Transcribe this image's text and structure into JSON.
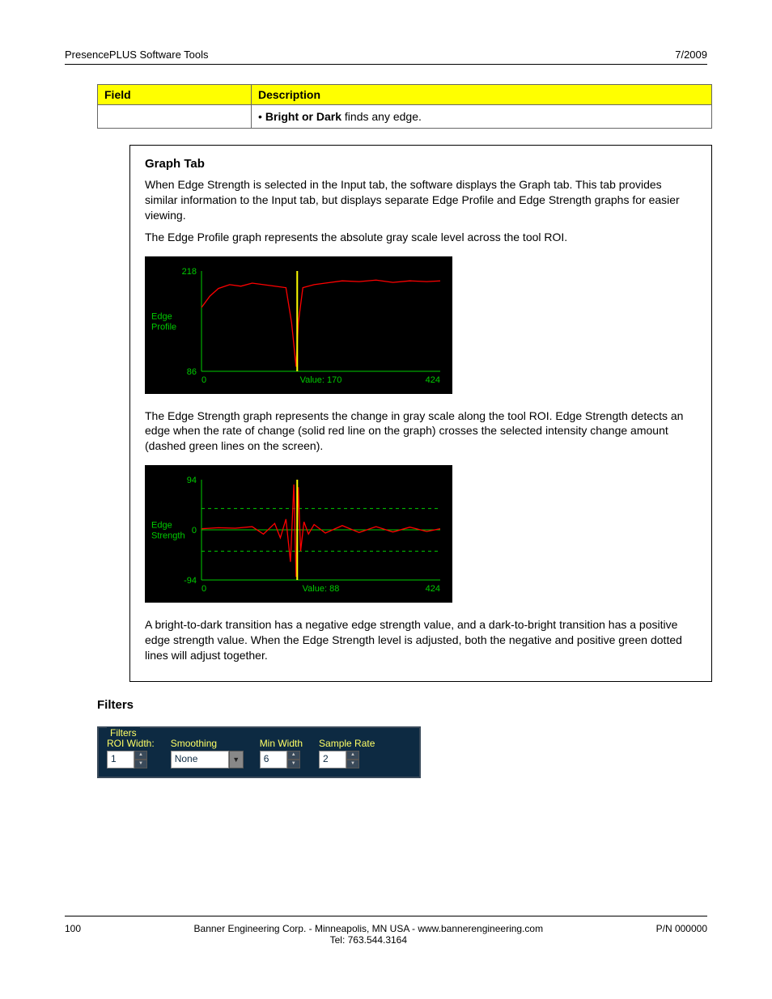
{
  "header": {
    "left": "PresencePLUS Software Tools",
    "right": "7/2009"
  },
  "table": {
    "headers": {
      "field": "Field",
      "description": "Description"
    },
    "row": {
      "field": "",
      "bold": "Bright or Dark",
      "rest": " finds any edge."
    }
  },
  "graph_tab": {
    "title": "Graph Tab",
    "p1": "When Edge Strength is selected in the Input tab, the software displays the Graph tab. This tab provides similar information to the Input tab, but displays separate Edge Profile and Edge Strength graphs for easier viewing.",
    "p2": "The Edge Profile graph represents the absolute gray scale level across the tool ROI.",
    "p3": "The Edge Strength graph represents the change in gray scale along the tool ROI. Edge Strength detects an edge when the rate of change (solid red line on the graph) crosses the selected intensity change amount (dashed green lines on the screen).",
    "p4": "A bright-to-dark transition has a negative edge strength value, and a dark-to-bright transition has a positive edge strength value. When the Edge Strength level is adjusted, both the negative and positive green dotted lines will adjust together."
  },
  "chart_data": [
    {
      "type": "line",
      "name": "Edge Profile",
      "ylabel": "Edge Profile",
      "ylim": [
        86,
        218
      ],
      "xlim": [
        0,
        424
      ],
      "xticks": [
        "0",
        "424"
      ],
      "yticks": [
        "86",
        "218"
      ],
      "marker_x": 170,
      "marker_label": "Value:  170",
      "series": [
        {
          "name": "profile",
          "color": "#ff0000",
          "x": [
            0,
            15,
            30,
            50,
            70,
            90,
            110,
            130,
            150,
            160,
            168,
            172,
            180,
            190,
            200,
            220,
            250,
            280,
            310,
            340,
            370,
            400,
            424
          ],
          "values": [
            170,
            185,
            195,
            200,
            198,
            202,
            200,
            198,
            196,
            150,
            92,
            150,
            196,
            198,
            200,
            202,
            205,
            204,
            206,
            203,
            205,
            204,
            205
          ]
        }
      ]
    },
    {
      "type": "line",
      "name": "Edge Strength",
      "ylabel": "Edge Strength",
      "ylim": [
        -94,
        94
      ],
      "xlim": [
        0,
        424
      ],
      "xticks": [
        "0",
        "424"
      ],
      "yticks": [
        "-94",
        "0",
        "94"
      ],
      "thresholds": [
        40,
        -40
      ],
      "marker_x": 170,
      "marker_label": "Value:  88",
      "series": [
        {
          "name": "strength",
          "color": "#ff0000",
          "x": [
            0,
            30,
            60,
            90,
            110,
            130,
            140,
            150,
            158,
            164,
            168,
            172,
            176,
            182,
            190,
            200,
            220,
            250,
            280,
            310,
            340,
            370,
            400,
            424
          ],
          "values": [
            2,
            4,
            3,
            6,
            -8,
            12,
            -15,
            20,
            -60,
            85,
            -88,
            80,
            -40,
            15,
            -8,
            10,
            -6,
            8,
            -5,
            6,
            -4,
            5,
            -3,
            2
          ]
        }
      ]
    }
  ],
  "filters": {
    "heading": "Filters",
    "legend": "Filters",
    "roi_width": {
      "label": "ROI Width:",
      "value": "1"
    },
    "smoothing": {
      "label": "Smoothing",
      "value": "None"
    },
    "min_width": {
      "label": "Min Width",
      "value": "6"
    },
    "sample_rate": {
      "label": "Sample Rate",
      "value": "2"
    }
  },
  "footer": {
    "page": "100",
    "center1": "Banner Engineering Corp. - Minneapolis, MN USA - www.bannerengineering.com",
    "center2": "Tel: 763.544.3164",
    "right": "P/N 000000"
  }
}
